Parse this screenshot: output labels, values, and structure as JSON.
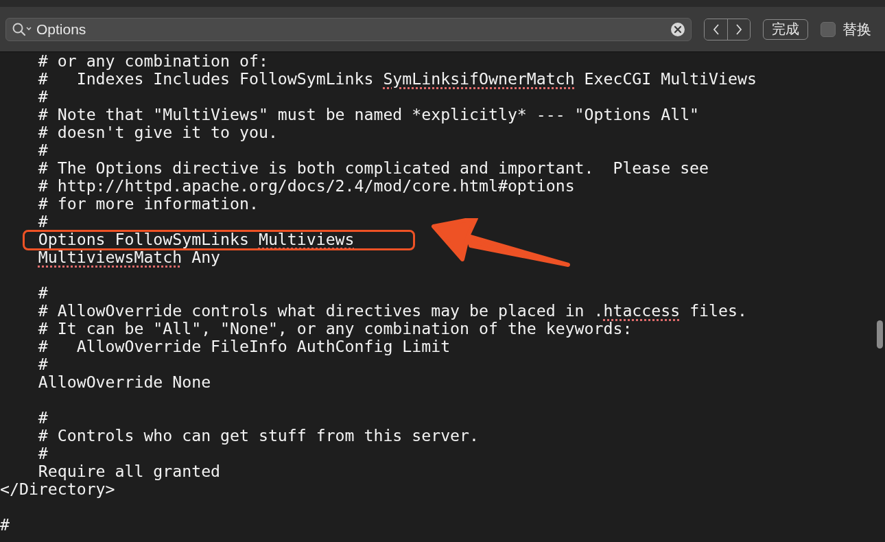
{
  "find_bar": {
    "search_value": "Options",
    "done_button": "完成",
    "replace": {
      "label": "替换",
      "checked": false
    }
  },
  "editor": {
    "lines": [
      {
        "text": "    # or any combination of:"
      },
      {
        "segments": [
          "    #   Indexes Includes FollowSymLinks ",
          {
            "text": "SymLinksifOwnerMatch",
            "misspelled": true
          },
          " ExecCGI MultiViews"
        ]
      },
      {
        "text": "    #"
      },
      {
        "text": "    # Note that \"MultiViews\" must be named *explicitly* --- \"Options All\""
      },
      {
        "text": "    # doesn't give it to you."
      },
      {
        "text": "    #"
      },
      {
        "text": "    # The Options directive is both complicated and important.  Please see"
      },
      {
        "text": "    # http://httpd.apache.org/docs/2.4/mod/core.html#options"
      },
      {
        "text": "    # for more information."
      },
      {
        "text": "    #"
      },
      {
        "boxed": true,
        "segments": [
          "    Options FollowSymLinks ",
          {
            "text": "Multiviews",
            "misspelled": true
          }
        ]
      },
      {
        "indented": true,
        "segments": [
          {
            "text": "MultiviewsMatch",
            "misspelled": true
          },
          " Any"
        ]
      },
      {
        "blank_line_before": true,
        "text": "    #"
      },
      {
        "segments": [
          "    # AllowOverride controls what directives may be placed in .",
          {
            "text": "htaccess",
            "misspelled": true
          },
          " files."
        ]
      },
      {
        "text": "    # It can be \"All\", \"None\", or any combination of the keywords:"
      },
      {
        "text": "    #   AllowOverride FileInfo AuthConfig Limit"
      },
      {
        "text": "    #"
      },
      {
        "text": "    AllowOverride None"
      },
      {
        "blank_line_before": true,
        "text": "    #"
      },
      {
        "text": "    # Controls who can get stuff from this server."
      },
      {
        "text": "    #"
      },
      {
        "text": "    Require all granted"
      },
      {
        "text": "</Directory>"
      },
      {
        "blank_line_before": true,
        "text": "#"
      }
    ]
  }
}
